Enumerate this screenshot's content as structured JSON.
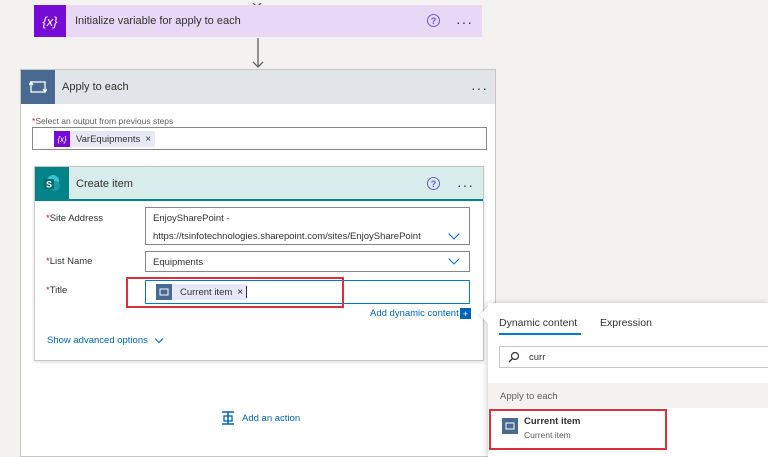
{
  "init_step": {
    "title": "Initialize variable for apply to each",
    "icon": "variable-icon",
    "color": "#770bd6"
  },
  "apply_step": {
    "title": "Apply to each",
    "color": "#486991",
    "output_label": "Select an output from previous steps",
    "output_token": "VarEquipments"
  },
  "create_item": {
    "title": "Create item",
    "color": "#038387",
    "site_label": "Site Address",
    "site_value_1": "EnjoySharePoint -",
    "site_value_2": "https://tsinfotechnologies.sharepoint.com/sites/EnjoySharePoint",
    "list_label": "List Name",
    "list_value": "Equipments",
    "title_label": "Title",
    "title_token": "Current item",
    "add_dynamic": "Add dynamic content",
    "advanced": "Show advanced options"
  },
  "add_action": "Add an action",
  "dynamic_panel": {
    "tabs": [
      "Dynamic content",
      "Expression"
    ],
    "search_value": "curr",
    "section": "Apply to each",
    "item_title": "Current item",
    "item_sub": "Current item"
  },
  "required_mark": "*"
}
